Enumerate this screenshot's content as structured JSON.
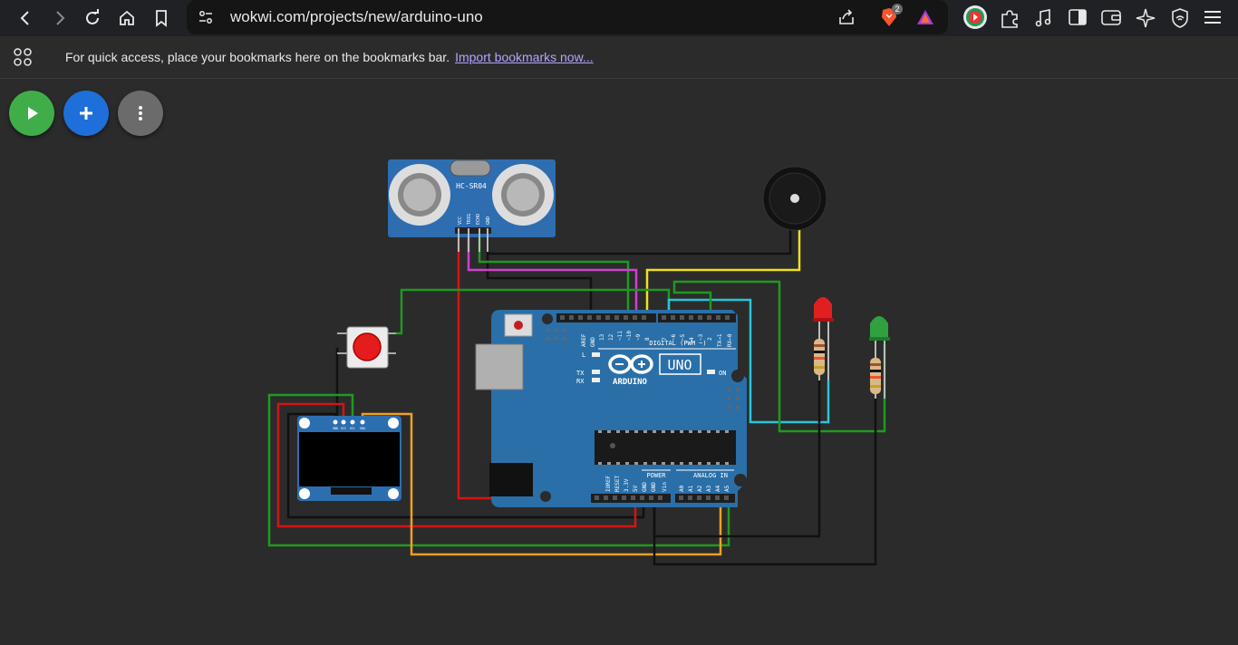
{
  "browser": {
    "url": "wokwi.com/projects/new/arduino-uno",
    "shield_count": "2"
  },
  "bookmarks_bar": {
    "message": "For quick access, place your bookmarks here on the bookmarks bar.",
    "link": "Import bookmarks now..."
  },
  "colors": {
    "play": "#3fae49",
    "add": "#1e6fd9",
    "more": "#6b6b6b",
    "board": "#2a6fa8"
  },
  "components": {
    "ultrasonic": {
      "label": "HC-SR04",
      "pins": [
        "VCC",
        "TRIG",
        "ECHO",
        "GND"
      ]
    },
    "arduino": {
      "logo_text": "ARDUINO",
      "model": "UNO",
      "digital_label": "DIGITAL (PWM ~)",
      "power_label": "POWER",
      "analog_label": "ANALOG IN",
      "on_label": "ON",
      "l_label": "L",
      "tx_label": "TX",
      "rx_label": "RX",
      "aref": "AREF",
      "gnd": "GND",
      "top_pins": [
        "13",
        "12",
        "~11",
        "~10",
        "~9",
        "8",
        "7",
        "~6",
        "~5",
        "4",
        "~3",
        "2",
        "TX→1",
        "RX←0"
      ],
      "power_pins": [
        "IOREF",
        "RESET",
        "3.3V",
        "5V",
        "GND",
        "GND",
        "Vin"
      ],
      "analog_pins": [
        "A0",
        "A1",
        "A2",
        "A3",
        "A4",
        "A5"
      ]
    },
    "oled": {
      "pins": [
        "GND",
        "VCC",
        "SCL",
        "SDA"
      ]
    }
  }
}
